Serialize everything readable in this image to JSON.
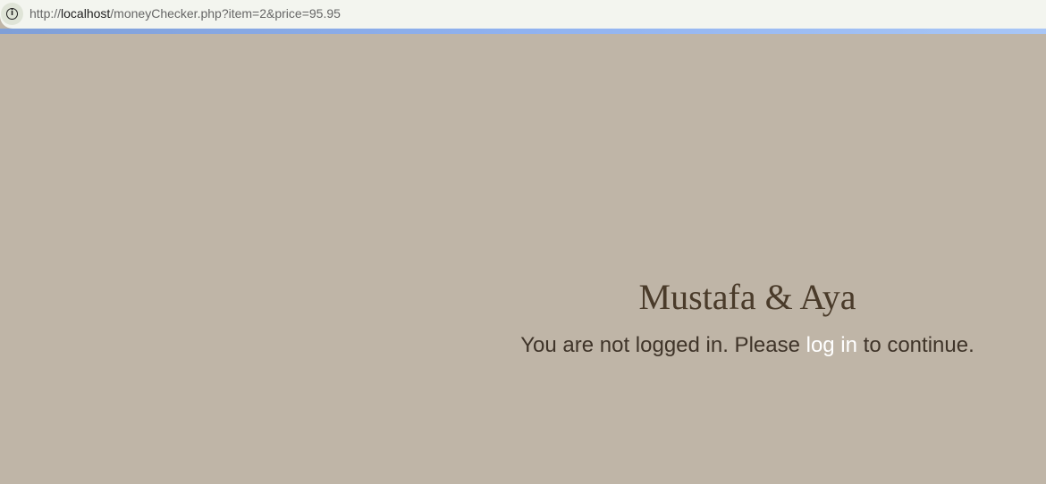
{
  "browser": {
    "address_bar": {
      "icon": "info-icon",
      "url_prefix": "http://",
      "url_host": "localhost",
      "url_path": "/moneyChecker.php?item=2&price=95.95"
    }
  },
  "page": {
    "title": "Mustafa & Aya",
    "message_before": "You are not logged in. Please ",
    "login_link": "log in",
    "message_after": " to continue."
  },
  "colors": {
    "background": "#bfb5a7",
    "title": "#4a3b2a",
    "text": "#3f3429",
    "link": "#ffffff"
  }
}
